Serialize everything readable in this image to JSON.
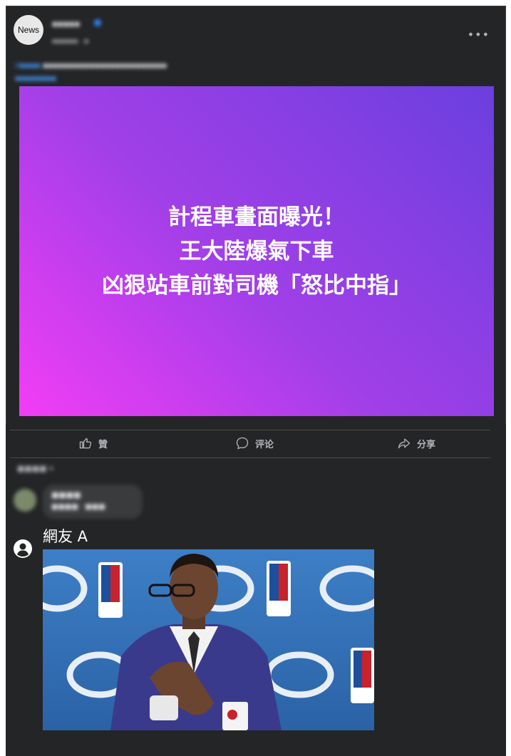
{
  "post": {
    "avatar_text": "News",
    "page_name": "■■■■■",
    "timestamp": "■■■■■■ · ■",
    "text_tag": "#■■■■",
    "text_body": " ■■■■■■■■■■■■■■■■■■■■■■■■",
    "text_line2": "■■■■■■■■",
    "headline": [
      "計程車畫面曝光！",
      "王大陸爆氣下車",
      "凶狠站車前對司機「怒比中指」"
    ]
  },
  "actions": {
    "like": "贊",
    "comment": "评论",
    "share": "分享"
  },
  "sort_label": "■■■■ ▾",
  "blurred_comment": {
    "name": "■■■■",
    "text": "■■■■ · ■■■"
  },
  "reply": {
    "user": "網友 A"
  },
  "colors": {
    "panel": "#242526",
    "gradient_start": "#f23df5",
    "gradient_end": "#6b3fde"
  }
}
